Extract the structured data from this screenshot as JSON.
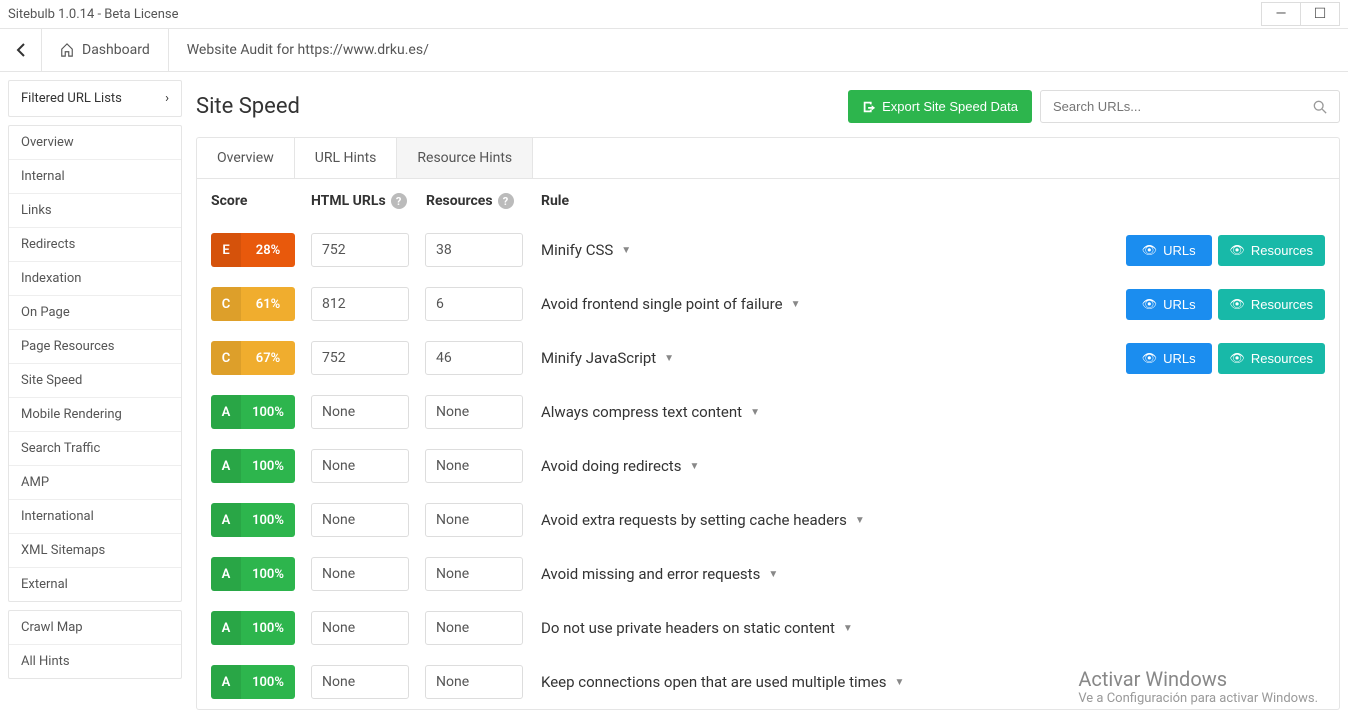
{
  "window": {
    "title": "Sitebulb 1.0.14  - Beta License",
    "minimize": "—",
    "maximize": "☐"
  },
  "topnav": {
    "dashboard": "Dashboard",
    "breadcrumb": "Website Audit for https://www.drku.es/"
  },
  "sidebar": {
    "filtered_header": "Filtered URL Lists",
    "groupA": [
      "Overview",
      "Internal",
      "Links",
      "Redirects",
      "Indexation",
      "On Page",
      "Page Resources",
      "Site Speed",
      "Mobile Rendering",
      "Search Traffic",
      "AMP",
      "International",
      "XML Sitemaps",
      "External"
    ],
    "groupB": [
      "Crawl Map",
      "All Hints"
    ]
  },
  "page": {
    "title": "Site Speed",
    "export_label": "Export Site Speed Data",
    "search_placeholder": "Search URLs..."
  },
  "tabs": [
    "Overview",
    "URL Hints",
    "Resource Hints"
  ],
  "active_tab": 2,
  "headers": {
    "score": "Score",
    "html": "HTML URLs",
    "resources": "Resources",
    "rule": "Rule"
  },
  "buttons": {
    "urls": "URLs",
    "resources": "Resources"
  },
  "rows": [
    {
      "grade": "E",
      "pct": "28%",
      "html": "752",
      "res": "38",
      "rule": "Minify CSS",
      "actions": true
    },
    {
      "grade": "C",
      "pct": "61%",
      "html": "812",
      "res": "6",
      "rule": "Avoid frontend single point of failure",
      "actions": true
    },
    {
      "grade": "C",
      "pct": "67%",
      "html": "752",
      "res": "46",
      "rule": "Minify JavaScript",
      "actions": true
    },
    {
      "grade": "A",
      "pct": "100%",
      "html": "None",
      "res": "None",
      "rule": "Always compress text content",
      "actions": false
    },
    {
      "grade": "A",
      "pct": "100%",
      "html": "None",
      "res": "None",
      "rule": "Avoid doing redirects",
      "actions": false
    },
    {
      "grade": "A",
      "pct": "100%",
      "html": "None",
      "res": "None",
      "rule": "Avoid extra requests by setting cache headers",
      "actions": false
    },
    {
      "grade": "A",
      "pct": "100%",
      "html": "None",
      "res": "None",
      "rule": "Avoid missing and error requests",
      "actions": false
    },
    {
      "grade": "A",
      "pct": "100%",
      "html": "None",
      "res": "None",
      "rule": "Do not use private headers on static content",
      "actions": false
    },
    {
      "grade": "A",
      "pct": "100%",
      "html": "None",
      "res": "None",
      "rule": "Keep connections open that are used multiple times",
      "actions": false
    }
  ],
  "watermark": {
    "title": "Activar Windows",
    "sub": "Ve a Configuración para activar Windows."
  }
}
